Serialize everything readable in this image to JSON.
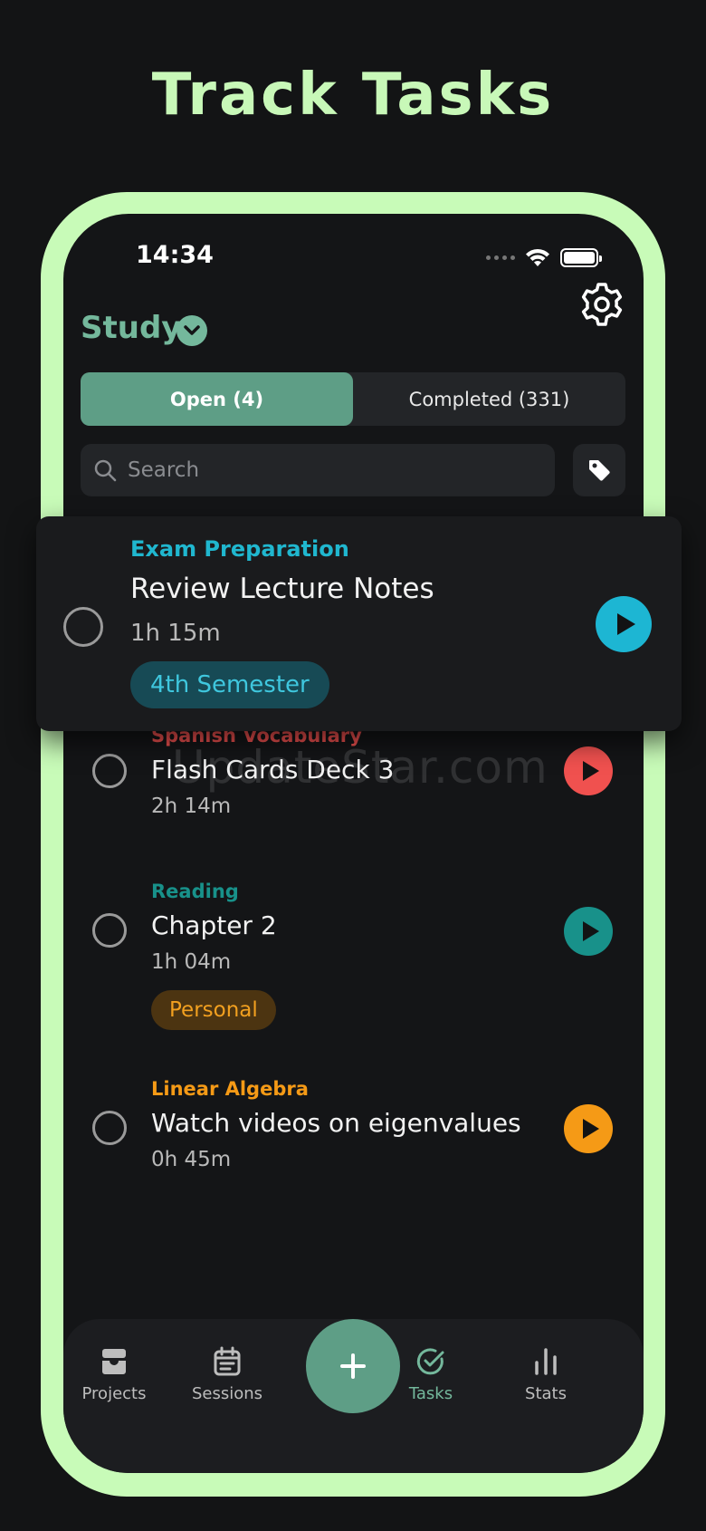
{
  "headline": "Track Tasks",
  "status_bar": {
    "time": "14:34"
  },
  "header": {
    "project_name": "Study"
  },
  "tabs": [
    {
      "label": "Open (4)",
      "active": true
    },
    {
      "label": "Completed (331)",
      "active": false
    }
  ],
  "search": {
    "placeholder": "Search",
    "value": ""
  },
  "floating_task": {
    "project": "Exam Preparation",
    "title": "Review Lecture Notes",
    "duration": "1h 15m",
    "tag": "4th Semester",
    "color": "#1db6d3"
  },
  "tasks": [
    {
      "project": "Spanish Vocabulary",
      "title": "Flash Cards Deck 3",
      "duration": "2h 14m",
      "color": "#f0514f"
    },
    {
      "project": "Reading",
      "title": "Chapter 2",
      "duration": "1h 04m",
      "tag": "Personal",
      "color": "#18918a"
    },
    {
      "project": "Linear Algebra",
      "title": "Watch videos on eigenvalues",
      "duration": "0h 45m",
      "color": "#f59a16"
    }
  ],
  "nav": {
    "projects": "Projects",
    "sessions": "Sessions",
    "tasks": "Tasks",
    "stats": "Stats",
    "active": "tasks"
  },
  "watermark": "UpdateStar.com",
  "colors": {
    "accent": "#74b89c",
    "frame": "#c8fbb8",
    "background": "#131415"
  }
}
